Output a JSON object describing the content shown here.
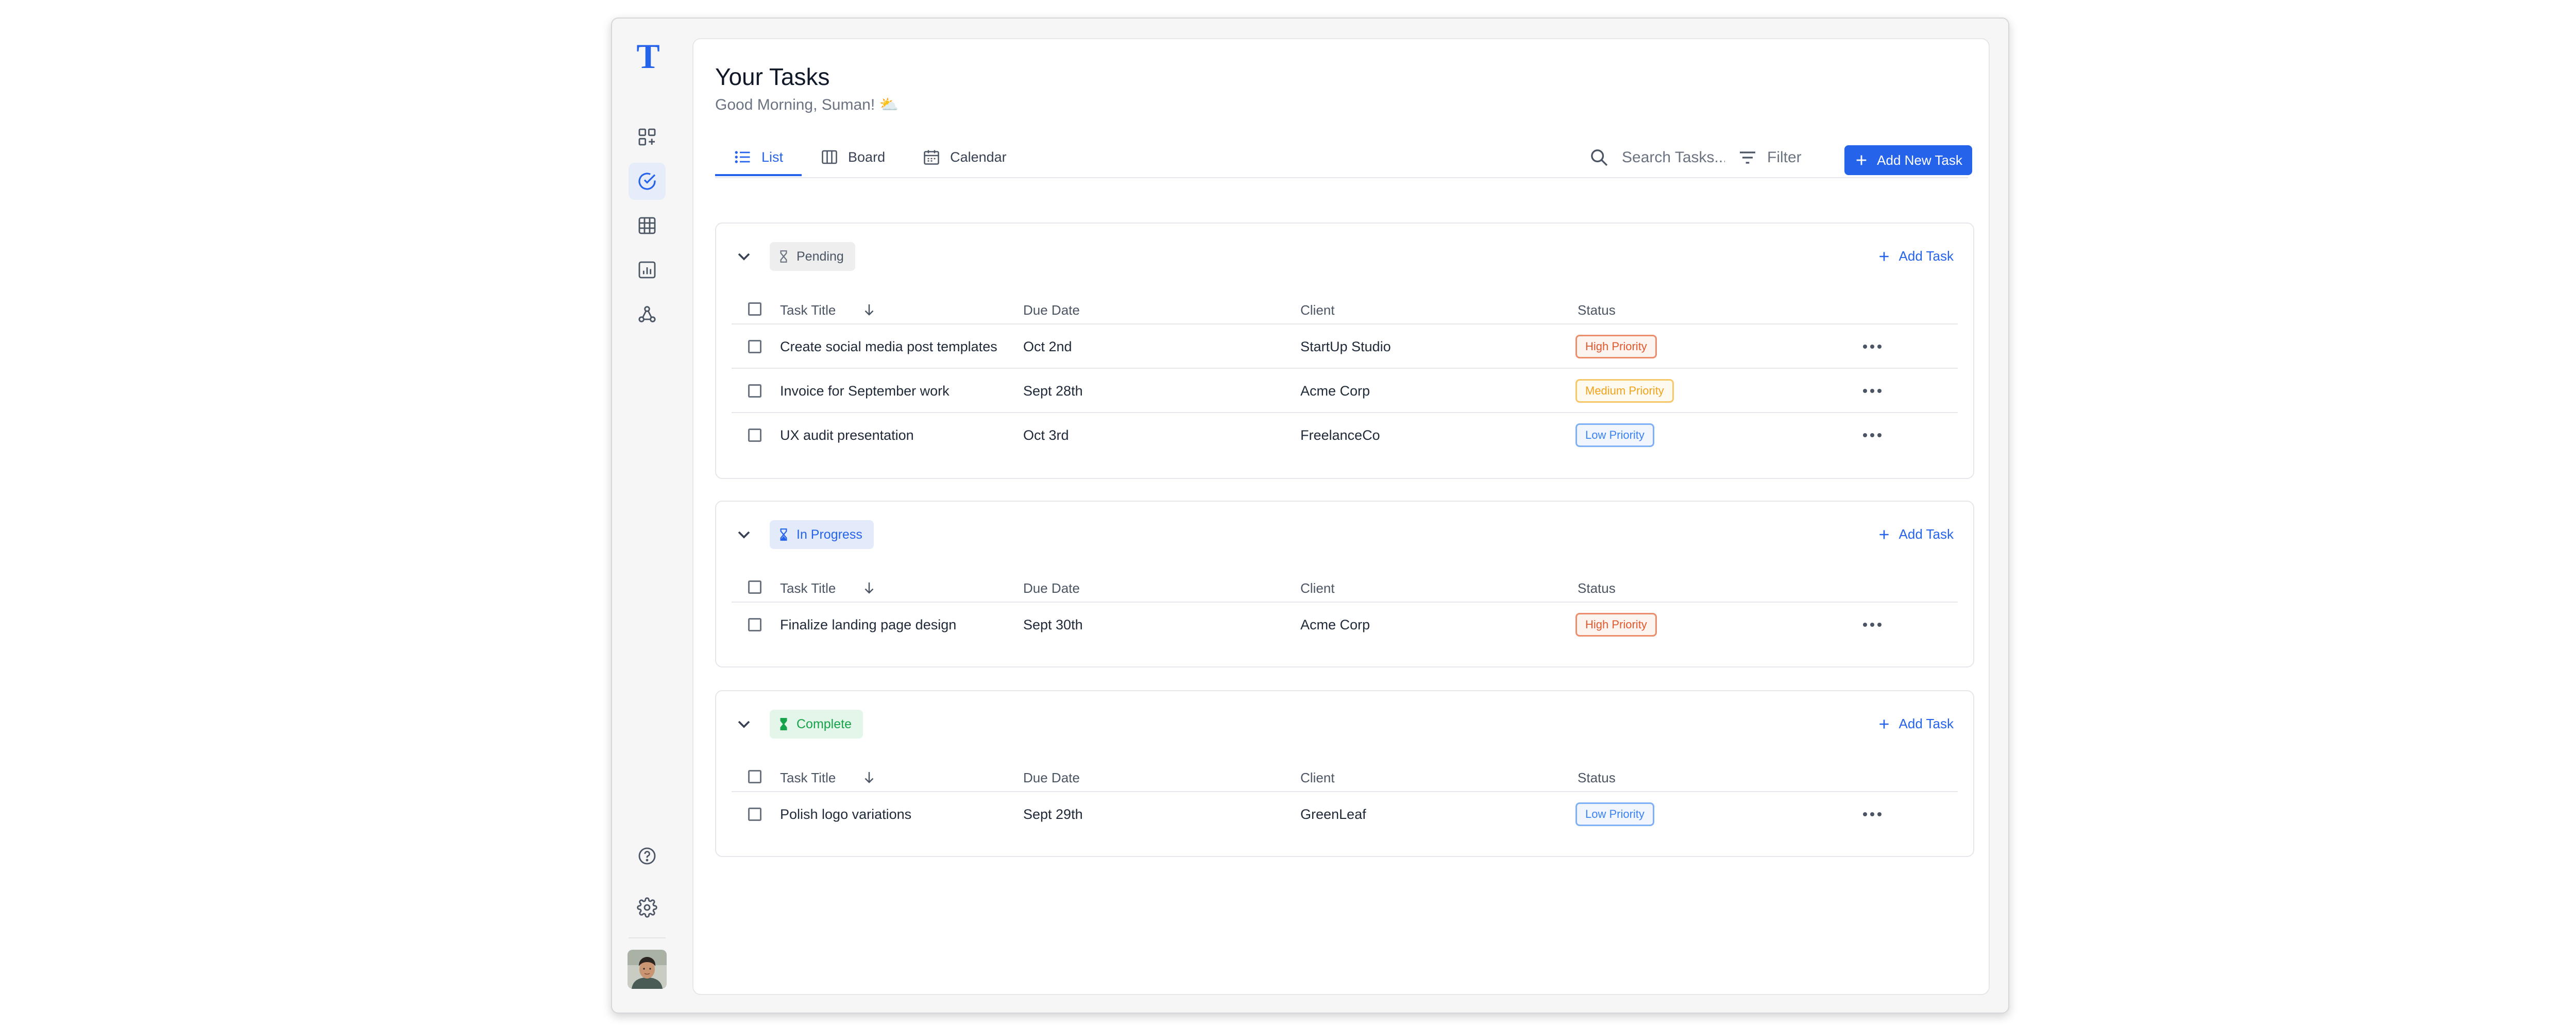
{
  "app": {
    "logo": "T"
  },
  "sidebar": {
    "items": [
      {
        "name": "dashboard-add-icon"
      },
      {
        "name": "tasks-check-icon",
        "active": true
      },
      {
        "name": "grid-icon"
      },
      {
        "name": "report-chart-icon"
      },
      {
        "name": "network-icon"
      }
    ],
    "bottom": [
      {
        "name": "help-icon"
      },
      {
        "name": "settings-icon"
      }
    ]
  },
  "header": {
    "title": "Your Tasks",
    "greeting": "Good Morning, Suman! ⛅"
  },
  "tabs": [
    {
      "label": "List",
      "icon": "list-icon",
      "active": true
    },
    {
      "label": "Board",
      "icon": "board-columns-icon"
    },
    {
      "label": "Calendar",
      "icon": "calendar-icon"
    }
  ],
  "toolbar": {
    "search_placeholder": "Search Tasks...",
    "filter_label": "Filter",
    "add_new_label": "Add New Task"
  },
  "columns": {
    "title": "Task Title",
    "due": "Due Date",
    "client": "Client",
    "status": "Status"
  },
  "groups": [
    {
      "status": "Pending",
      "add_label": "Add Task",
      "tasks": [
        {
          "title": "Create social media post templates",
          "due": "Oct 2nd",
          "client": "StartUp Studio",
          "priority": "High Priority"
        },
        {
          "title": "Invoice for September work",
          "due": "Sept 28th",
          "client": "Acme Corp",
          "priority": "Medium Priority"
        },
        {
          "title": "UX audit presentation",
          "due": "Oct 3rd",
          "client": "FreelanceCo",
          "priority": "Low Priority"
        }
      ]
    },
    {
      "status": "In Progress",
      "add_label": "Add Task",
      "tasks": [
        {
          "title": "Finalize landing page design",
          "due": "Sept 30th",
          "client": "Acme Corp",
          "priority": "High Priority"
        }
      ]
    },
    {
      "status": "Complete",
      "add_label": "Add Task",
      "tasks": [
        {
          "title": "Polish logo variations",
          "due": "Sept 29th",
          "client": "GreenLeaf",
          "priority": "Low Priority"
        }
      ]
    }
  ],
  "colors": {
    "accent": "#2563eb",
    "high": "#e2572c",
    "medium": "#f0a21a",
    "low": "#3b82f6",
    "complete": "#16a34a"
  }
}
